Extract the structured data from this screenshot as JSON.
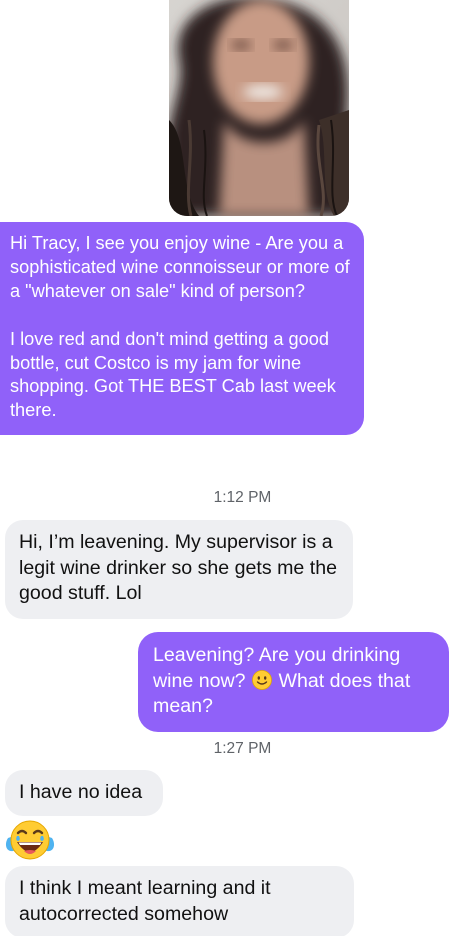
{
  "conversation": {
    "messages": [
      {
        "direction": "outgoing",
        "text_1": "Hi Tracy, I see you enjoy wine - Are you a sophisticated wine connoisseur or more of a \"whatever on sale\" kind of person?",
        "text_2": "I love red and don't mind getting a good bottle, cut Costco is my jam for wine shopping. Got THE BEST Cab last week there."
      },
      {
        "direction": "incoming",
        "text": "Hi, I’m leavening. My supervisor is a legit wine drinker so she gets me the good stuff. Lol"
      },
      {
        "direction": "outgoing",
        "text_before_emoji": "Leavening? Are you drinking wine now? ",
        "emoji": "slightly-smiling-face",
        "text_after_emoji": " What does that mean?"
      },
      {
        "direction": "incoming",
        "text": "I have no idea"
      },
      {
        "direction": "incoming",
        "emoji": "face-with-tears-of-joy"
      },
      {
        "direction": "incoming",
        "text": "I think I meant learning and it autocorrected somehow"
      }
    ],
    "timestamps": [
      "1:12 PM",
      "1:27 PM"
    ]
  },
  "colors": {
    "outgoing_bubble": "#9061f9",
    "incoming_bubble": "#eeeff2",
    "timestamp_text": "#5f6368"
  },
  "icons": {
    "photo": "profile-photo-blurred",
    "inline_emoji": "slightly-smiling-face-icon",
    "big_emoji": "face-with-tears-of-joy-icon"
  }
}
